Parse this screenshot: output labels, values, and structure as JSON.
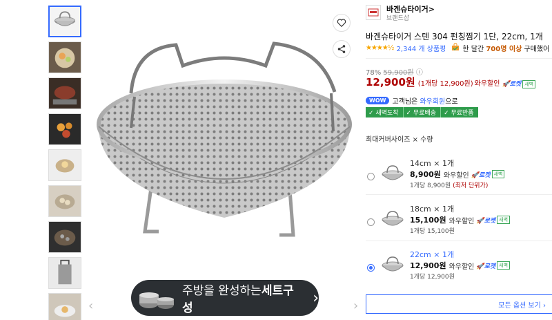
{
  "brand": {
    "name": "바겐슈타이거",
    "chevron": ">",
    "sub": "브랜드샵"
  },
  "product": {
    "title": "바겐슈타이거 스텐 304 펀칭찜기 1단, 22cm, 1개",
    "stars": "★★★★½",
    "rating_count": "2,344 개 상품평",
    "purchase_text_a": "한 달간",
    "purchase_count": "700명 이상",
    "purchase_text_b": "구매했어"
  },
  "price": {
    "discount": "78%",
    "original": "59,900원",
    "info_icon": "ⓘ",
    "sale": "12,900원",
    "unit": "(1개당 12,900원)",
    "wow": "와우할인",
    "rocket": "로켓",
    "new_badge": "새벽"
  },
  "wow_member": {
    "badge": "WOW",
    "text_a": "고객님은",
    "link": "와우회원",
    "text_b": "으로"
  },
  "tags": [
    "✓ 새벽도착",
    "✓ 무료배송",
    "✓ 무료반품"
  ],
  "option_label": "최대커버사이즈 × 수량",
  "options": [
    {
      "size": "14cm × 1개",
      "price": "8,900원",
      "wow": "와우할인",
      "rocket": "로켓",
      "new_badge": "새벽",
      "unit": "1개당 8,900원",
      "note": "(최저 단위가)",
      "selected": false
    },
    {
      "size": "18cm × 1개",
      "price": "15,100원",
      "wow": "와우할인",
      "rocket": "로켓",
      "new_badge": "새벽",
      "unit": "1개당 15,100원",
      "note": "",
      "selected": false
    },
    {
      "size": "22cm × 1개",
      "price": "12,900원",
      "wow": "와우할인",
      "rocket": "로켓",
      "new_badge": "새벽",
      "unit": "1개당 12,900원",
      "note": "",
      "selected": true
    }
  ],
  "all_options_button": "모든 옵션 보기 ›",
  "banner": {
    "text_a": "주방을 완성하는",
    "text_b": "세트구성",
    "chevron": "›"
  },
  "carousel": {
    "prev": "‹",
    "next": "›"
  },
  "icons": {
    "heart": "heart-icon",
    "share": "share-icon",
    "rocket": "rocket-icon",
    "bag": "shopping-bag-icon"
  },
  "colors": {
    "accent": "#346aff",
    "price_red": "#ae0000",
    "green": "#2e9c4b",
    "star": "#f7a600",
    "banner_bg": "#2b2f33"
  }
}
